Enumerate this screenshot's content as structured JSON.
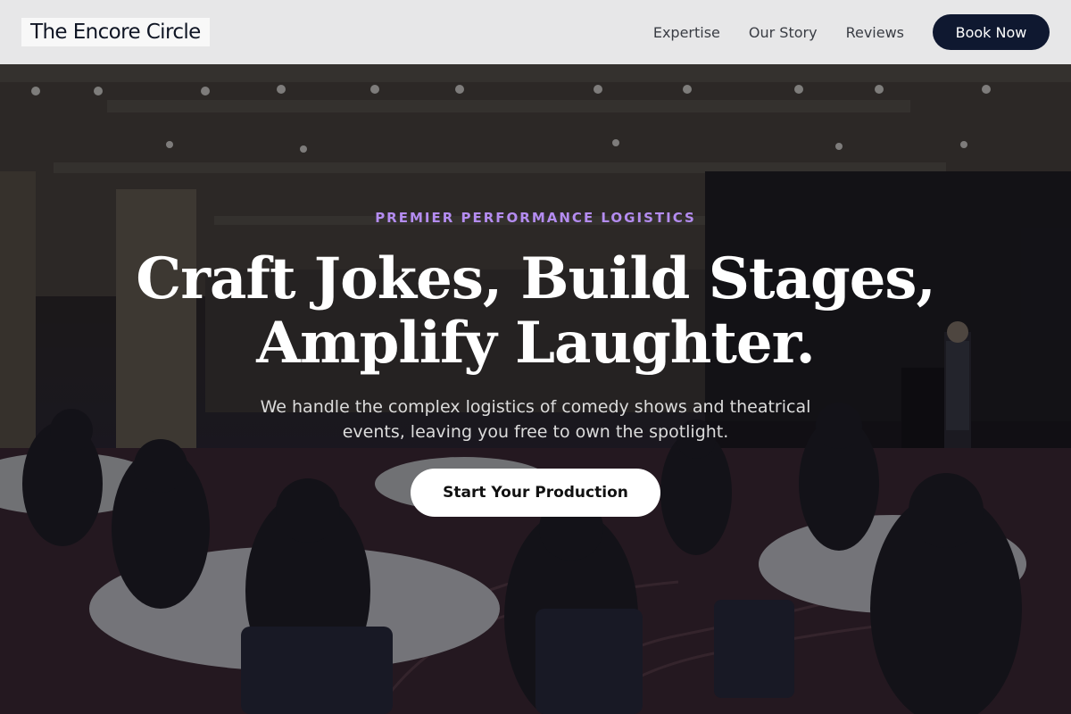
{
  "header": {
    "logo": "The Encore Circle",
    "nav": [
      "Expertise",
      "Our Story",
      "Reviews"
    ],
    "cta_label": "Book Now"
  },
  "hero": {
    "eyebrow": "PREMIER PERFORMANCE LOGISTICS",
    "headline_line1": "Craft Jokes, Build Stages,",
    "headline_line2": "Amplify Laughter.",
    "subtext": "We handle the complex logistics of comedy shows and theatrical events, leaving you free to own the spotlight.",
    "cta_label": "Start Your Production"
  },
  "colors": {
    "accent": "#b48cf0",
    "navy": "#0f1830",
    "header_bg": "#eeeeee"
  }
}
